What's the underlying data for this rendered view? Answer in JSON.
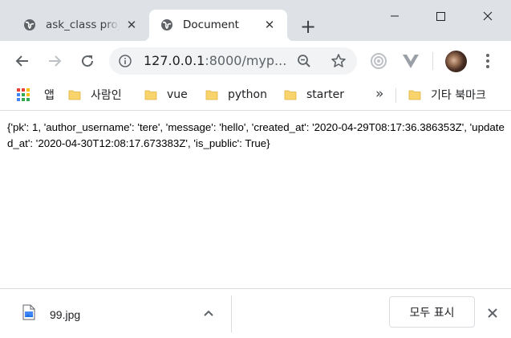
{
  "tabs": [
    {
      "title": "ask_class proj",
      "favicon": "globe-icon",
      "active": false
    },
    {
      "title": "Document",
      "favicon": "globe-icon",
      "active": true
    }
  ],
  "new_tab_icon": "plus-icon",
  "window_controls": [
    "minimize-icon",
    "maximize-icon",
    "close-icon"
  ],
  "toolbar": {
    "back_icon": "arrow-left-icon",
    "forward_icon": "arrow-right-icon",
    "reload_icon": "reload-icon",
    "url_host": "127.0.0.1",
    "url_rest": ":8000/myp...",
    "zoom_icon": "zoom-icon",
    "star_icon": "star-icon"
  },
  "bookmarks": [
    {
      "label": "앱",
      "icon": "apps-grid-icon"
    },
    {
      "label": "사람인",
      "icon": "folder-icon"
    },
    {
      "label": "vue",
      "icon": "folder-icon"
    },
    {
      "label": "python",
      "icon": "folder-icon"
    },
    {
      "label": "starter",
      "icon": "folder-icon"
    },
    {
      "label": "기타 북마크",
      "icon": "folder-icon"
    }
  ],
  "bookmarks_overflow": "»",
  "page": {
    "text": "{'pk': 1, 'author_username': 'tere', 'message': 'hello', 'created_at': '2020-04-29T08:17:36.386353Z', 'updated_at': '2020-04-30T12:08:17.673383Z', 'is_public': True}"
  },
  "downloads": {
    "file_name": "99.jpg",
    "show_all_label": "모두 표시"
  },
  "colors": {
    "tab_strip": "#dee1e6",
    "folder": "#f9d36b",
    "icon_gray": "#5f6368"
  }
}
